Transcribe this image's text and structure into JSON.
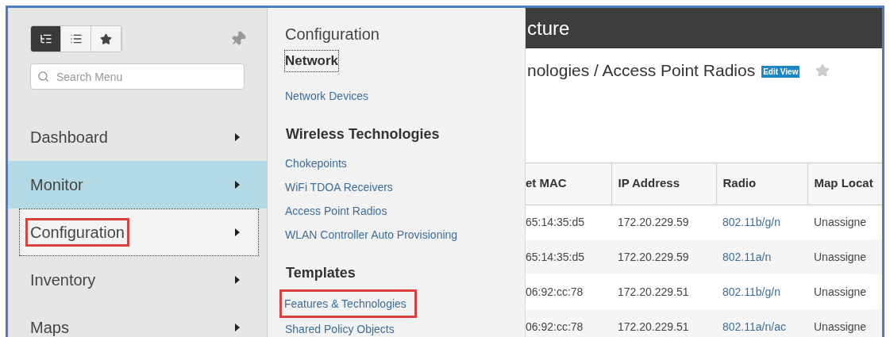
{
  "sidebar": {
    "view_toggles": [
      {
        "kind": "tree",
        "selected": true
      },
      {
        "kind": "list",
        "selected": false
      },
      {
        "kind": "favorites",
        "selected": false
      }
    ],
    "search": {
      "placeholder": "Search Menu"
    },
    "items": [
      {
        "label": "Dashboard",
        "selected": false,
        "focused": false,
        "highlighted": false
      },
      {
        "label": "Monitor",
        "selected": true,
        "focused": false,
        "highlighted": false
      },
      {
        "label": "Configuration",
        "selected": false,
        "focused": true,
        "highlighted": true
      },
      {
        "label": "Inventory",
        "selected": false,
        "focused": false,
        "highlighted": false
      },
      {
        "label": "Maps",
        "selected": false,
        "focused": false,
        "highlighted": false
      }
    ]
  },
  "flyout": {
    "title": "Configuration",
    "sections": [
      {
        "heading": "Network",
        "focused": true,
        "links": [
          {
            "label": "Network Devices",
            "highlighted": false
          }
        ]
      },
      {
        "heading": "Wireless Technologies",
        "focused": false,
        "links": [
          {
            "label": "Chokepoints",
            "highlighted": false
          },
          {
            "label": "WiFi TDOA Receivers",
            "highlighted": false
          },
          {
            "label": "Access Point Radios",
            "highlighted": false
          },
          {
            "label": "WLAN Controller Auto Provisioning",
            "highlighted": false
          }
        ]
      },
      {
        "heading": "Templates",
        "focused": false,
        "links": [
          {
            "label": "Features & Technologies",
            "highlighted": true
          },
          {
            "label": "Shared Policy Objects",
            "highlighted": false
          }
        ]
      }
    ]
  },
  "content": {
    "header_title": "cture",
    "breadcrumb": "nologies / Access Point Radios",
    "edit_view": "Edit View",
    "table": {
      "columns": [
        "et MAC",
        "IP Address",
        "Radio",
        "Map Locat"
      ],
      "rows": [
        [
          "65:14:35:d5",
          "172.20.229.59",
          "802.11b/g/n",
          "Unassigne"
        ],
        [
          "65:14:35:d5",
          "172.20.229.59",
          "802.11a/n",
          "Unassigne"
        ],
        [
          "06:92:cc:78",
          "172.20.229.51",
          "802.11b/g/n",
          "Unassigne"
        ],
        [
          "06:92:cc:78",
          "172.20.229.51",
          "802.11a/n/ac",
          "Unassigne"
        ]
      ]
    }
  }
}
